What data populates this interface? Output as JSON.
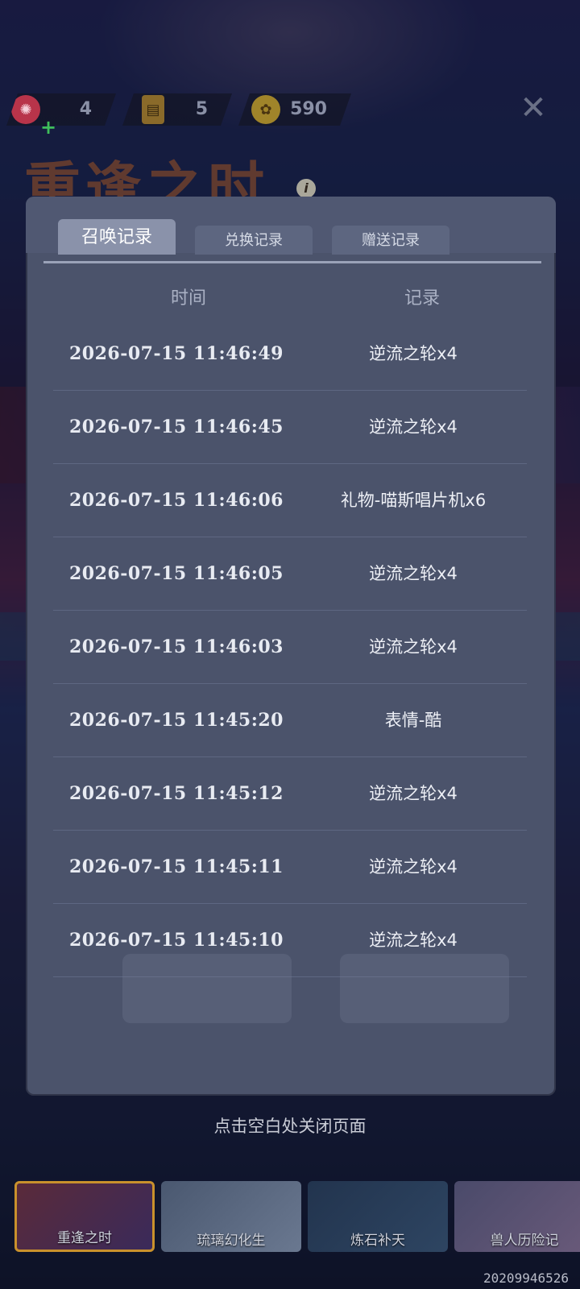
{
  "top_bar": {
    "currencies": [
      {
        "icon": "summon-candy-icon",
        "value": "4"
      },
      {
        "icon": "ticket-card-icon",
        "value": "5"
      },
      {
        "icon": "gold-coin-icon",
        "value": "590"
      }
    ],
    "close_symbol": "✕"
  },
  "event": {
    "title": "重逢之时",
    "info_symbol": "i"
  },
  "record_modal": {
    "tabs": [
      {
        "label": "召唤记录",
        "active": true
      },
      {
        "label": "兑换记录",
        "active": false
      },
      {
        "label": "赠送记录",
        "active": false
      }
    ],
    "columns": {
      "time": "时间",
      "record": "记录"
    },
    "rows": [
      {
        "time": "2026-07-15 11:46:49",
        "record": "逆流之轮x4"
      },
      {
        "time": "2026-07-15 11:46:45",
        "record": "逆流之轮x4"
      },
      {
        "time": "2026-07-15 11:46:06",
        "record": "礼物-喵斯唱片机x6"
      },
      {
        "time": "2026-07-15 11:46:05",
        "record": "逆流之轮x4"
      },
      {
        "time": "2026-07-15 11:46:03",
        "record": "逆流之轮x4"
      },
      {
        "time": "2026-07-15 11:45:20",
        "record": "表情-酷"
      },
      {
        "time": "2026-07-15 11:45:12",
        "record": "逆流之轮x4"
      },
      {
        "time": "2026-07-15 11:45:11",
        "record": "逆流之轮x4"
      },
      {
        "time": "2026-07-15 11:45:10",
        "record": "逆流之轮x4"
      }
    ]
  },
  "close_hint": "点击空白处关闭页面",
  "carousel": [
    {
      "label": "重逢之时",
      "active": true
    },
    {
      "label": "琉璃幻化生",
      "active": false
    },
    {
      "label": "炼石补天",
      "active": false
    },
    {
      "label": "兽人历险记",
      "active": false
    }
  ],
  "uid": "20209946526",
  "colors": {
    "panel_bg": "#4b536b",
    "active_tab": "#8a92aa",
    "inactive_tab": "#5d6680",
    "highlight_border": "#c9912c"
  }
}
